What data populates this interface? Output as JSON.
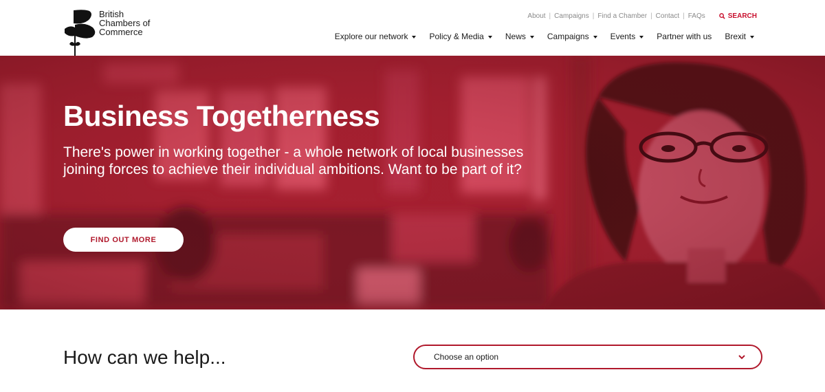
{
  "brand": {
    "line1": "British",
    "line2": "Chambers of",
    "line3": "Commerce"
  },
  "utility_nav": [
    "About",
    "Campaigns",
    "Find a Chamber",
    "Contact",
    "FAQs"
  ],
  "search_label": "SEARCH",
  "main_nav": [
    "Explore our network",
    "Policy & Media",
    "News",
    "Campaigns",
    "Events",
    "Partner with us",
    "Brexit"
  ],
  "hero": {
    "title": "Business Togetherness",
    "subtitle": "There's power in working together - a whole network of local businesses joining forces to achieve their individual ambitions. Want to be part of it?",
    "cta": "FIND OUT MORE"
  },
  "help": {
    "title": "How can we help...",
    "select_value": "Choose an option"
  },
  "colors": {
    "accent": "#b0182b",
    "hero_bg": "#a81d2d"
  }
}
